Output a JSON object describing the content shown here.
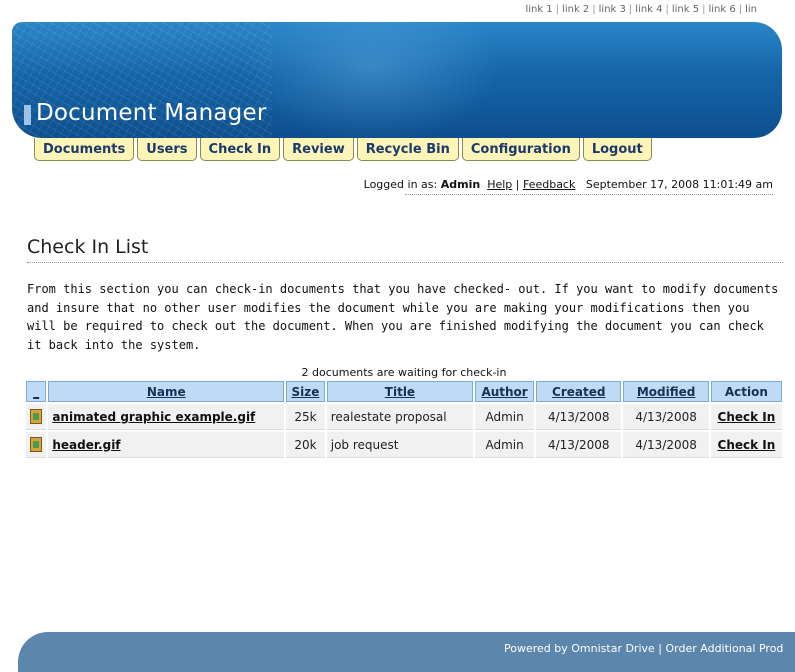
{
  "top_links": [
    "link 1",
    "link 2",
    "link 3",
    "link 4",
    "link 5",
    "link 6",
    "lin"
  ],
  "header": {
    "title": "Document Manager"
  },
  "nav": [
    "Documents",
    "Users",
    "Check In",
    "Review",
    "Recycle Bin",
    "Configuration",
    "Logout"
  ],
  "login": {
    "prefix": "Logged in as:",
    "user": "Admin",
    "help": "Help",
    "feedback": "Feedback",
    "datetime": "September 17, 2008 11:01:49 am"
  },
  "page": {
    "title": "Check In List",
    "intro": "From this section you can check-in documents that you have checked- out. If you want to modify documents and insure that no other user modifies the document while you are making your modifications then you will be required to check out the document. When you are finished modifying the document you can check it back into the system.",
    "count": "2 documents are waiting for check-in"
  },
  "table": {
    "headers": [
      "_",
      "Name",
      "Size",
      "Title",
      "Author",
      "Created",
      "Modified",
      "Action"
    ],
    "rows": [
      {
        "icon": "gif-file-icon",
        "name": "animated graphic example.gif",
        "size": "25k",
        "title": "realestate proposal",
        "author": "Admin",
        "created": "4/13/2008",
        "modified": "4/13/2008",
        "action": "Check In"
      },
      {
        "icon": "gif-file-icon",
        "name": "header.gif",
        "size": "20k",
        "title": "job request",
        "author": "Admin",
        "created": "4/13/2008",
        "modified": "4/13/2008",
        "action": "Check In"
      }
    ]
  },
  "footer": {
    "powered": "Powered by Omnistar Drive",
    "order": "Order Additional Prod"
  }
}
